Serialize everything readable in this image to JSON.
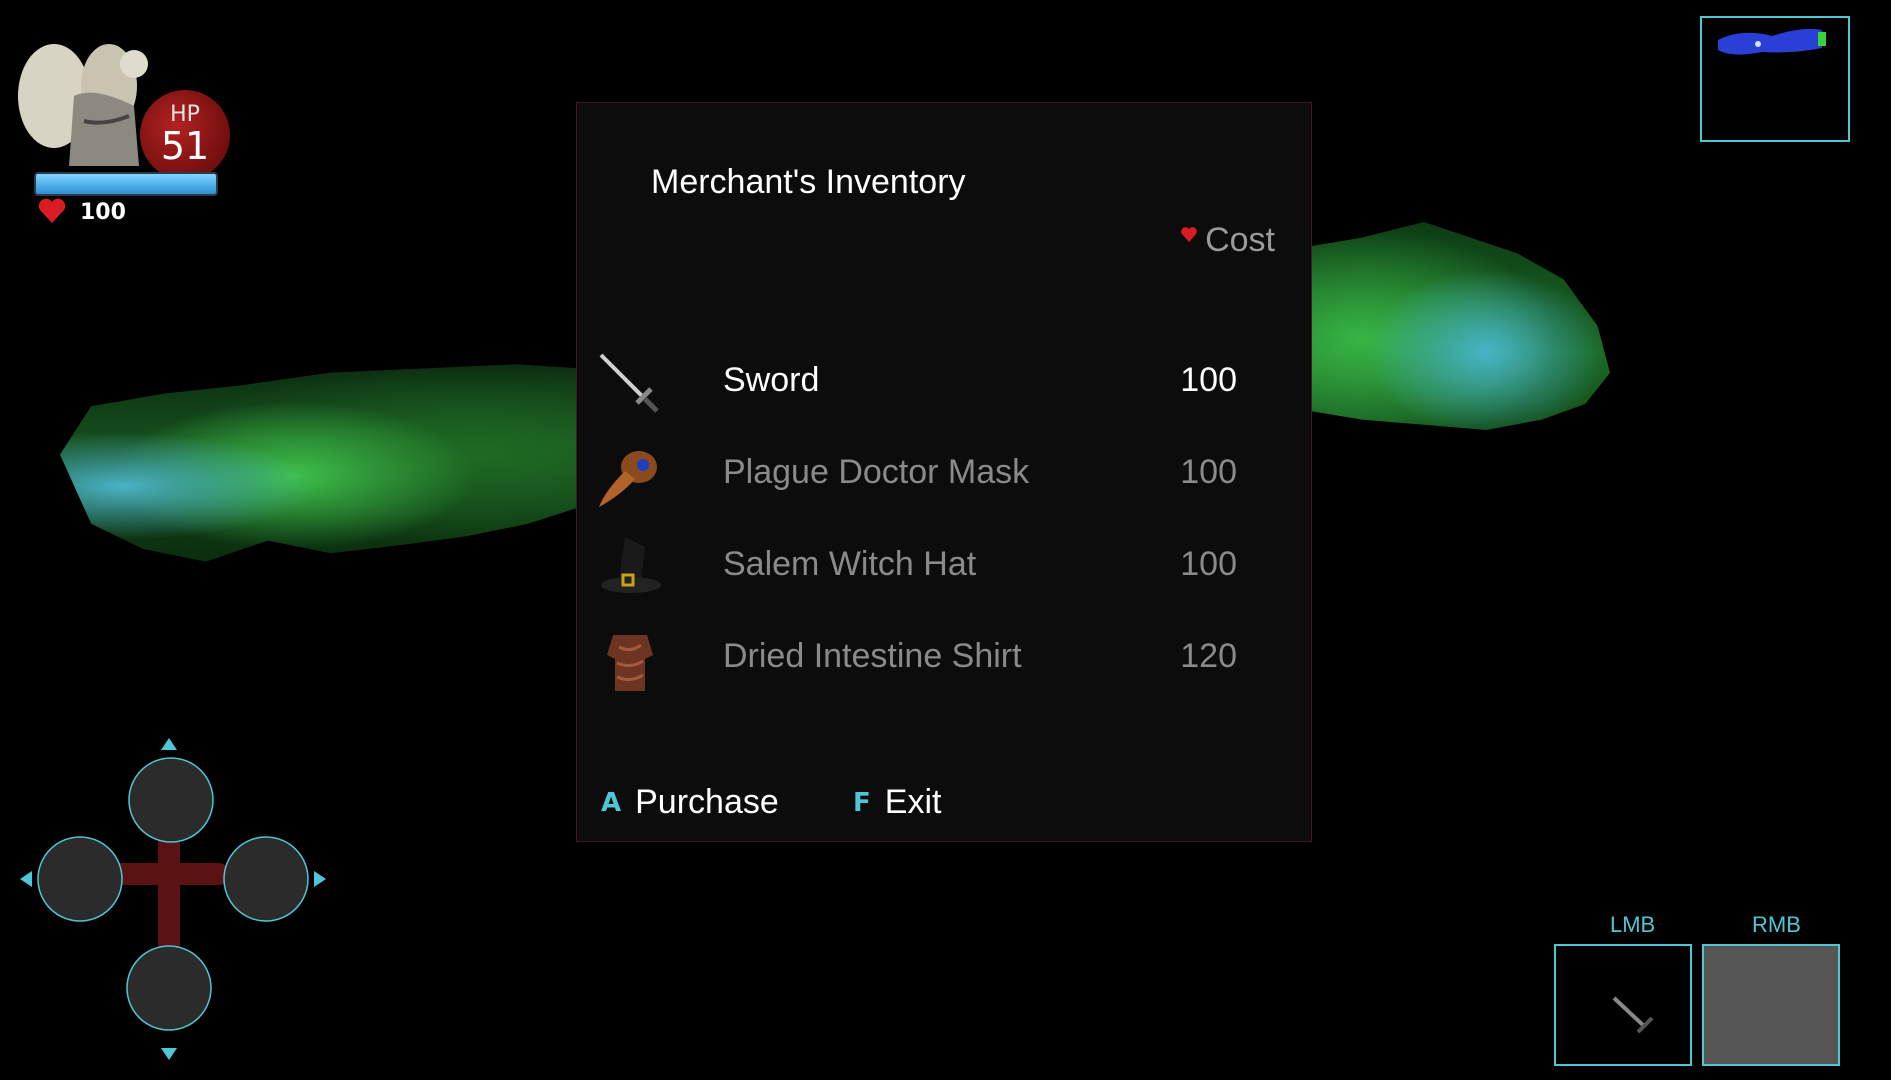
{
  "hud": {
    "hp_label": "HP",
    "hp_value": "51",
    "health_count": "100"
  },
  "merchant": {
    "title": "Merchant's Inventory",
    "cost_header": "Cost",
    "items": [
      {
        "name": "Sword",
        "cost": "100",
        "icon": "sword-icon",
        "selected": true
      },
      {
        "name": "Plague Doctor Mask",
        "cost": "100",
        "icon": "plague-mask-icon",
        "selected": false
      },
      {
        "name": "Salem Witch Hat",
        "cost": "100",
        "icon": "witch-hat-icon",
        "selected": false
      },
      {
        "name": "Dried Intestine Shirt",
        "cost": "120",
        "icon": "intestine-shirt-icon",
        "selected": false
      }
    ],
    "actions": [
      {
        "key": "A",
        "label": "Purchase"
      },
      {
        "key": "F",
        "label": "Exit"
      }
    ]
  },
  "slots": {
    "lmb_label": "LMB",
    "rmb_label": "RMB"
  },
  "colors": {
    "accent": "#4fc6d6",
    "panel_bg": "#0d0c0c",
    "hp_red": "#b22222",
    "heart_red": "#d91c24"
  }
}
